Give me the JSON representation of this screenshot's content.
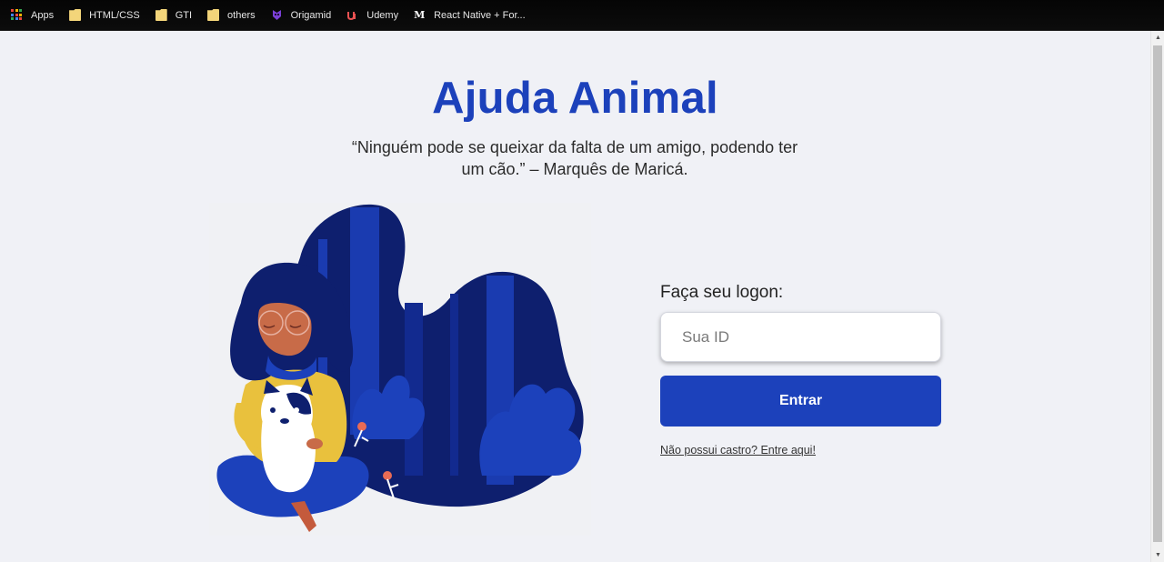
{
  "bookmarks": [
    {
      "label": "Apps",
      "icon": "apps-grid-icon"
    },
    {
      "label": "HTML/CSS",
      "icon": "folder-icon"
    },
    {
      "label": "GTI",
      "icon": "folder-icon"
    },
    {
      "label": "others",
      "icon": "folder-icon"
    },
    {
      "label": "Origamid",
      "icon": "origamid-icon"
    },
    {
      "label": "Udemy",
      "icon": "udemy-icon"
    },
    {
      "label": "React Native + For...",
      "icon": "medium-icon"
    }
  ],
  "page": {
    "title": "Ajuda Animal",
    "quote": "“Ninguém pode se queixar da falta de um amigo, podendo ter um cão.” – Marquês de Maricá."
  },
  "login": {
    "label": "Faça seu logon:",
    "id_placeholder": "Sua ID",
    "id_value": "",
    "submit_label": "Entrar",
    "register_link": "Não possui castro? Entre aqui!"
  },
  "colors": {
    "brand": "#1c41bb",
    "background": "#f0f1f6",
    "illustration_dark": "#0e1f6e",
    "illustration_mid": "#1a3bb0",
    "sweater": "#e9c13d"
  }
}
